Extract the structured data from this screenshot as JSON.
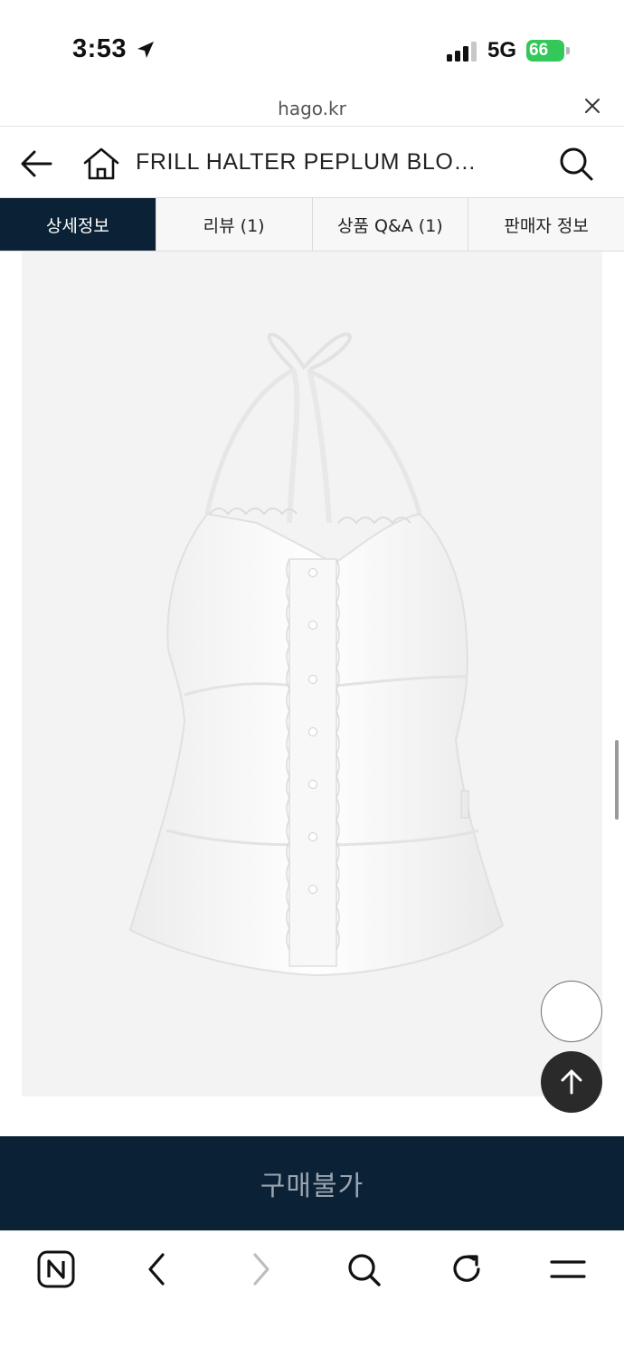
{
  "status_bar": {
    "time": "3:53",
    "network": "5G",
    "battery": "66",
    "icons": [
      "location-arrow-icon",
      "signal-bars-icon",
      "battery-charging-icon"
    ]
  },
  "browser": {
    "url": "hago.kr"
  },
  "header": {
    "title": "FRILL HALTER PEPLUM BLO…"
  },
  "tabs": [
    {
      "label": "상세정보",
      "active": true
    },
    {
      "label": "리뷰 (1)",
      "active": false
    },
    {
      "label": "상품 Q&A (1)",
      "active": false
    },
    {
      "label": "판매자 정보",
      "active": false
    }
  ],
  "purchase": {
    "label": "구매불가"
  },
  "toolbar": {
    "icons": [
      "naver-n-icon",
      "back-chevron-icon",
      "forward-chevron-icon",
      "search-icon",
      "refresh-icon",
      "menu-icon"
    ]
  },
  "colors": {
    "navy": "#0b2236",
    "battery_green": "#34c759",
    "image_bg": "#f3f3f3"
  }
}
